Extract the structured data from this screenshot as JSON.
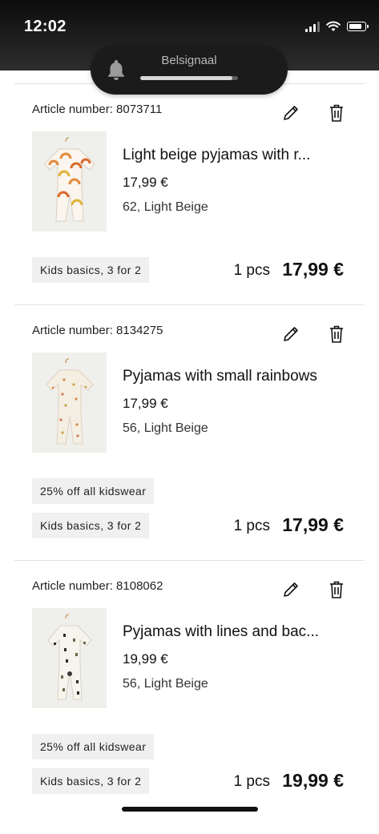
{
  "status_bar": {
    "time": "12:02"
  },
  "notification": {
    "title": "Belsignaal",
    "progress": 0.94
  },
  "cart_items": [
    {
      "article_label": "Article number: 8073711",
      "name": "Light beige pyjamas with r...",
      "price": "17,99 €",
      "variant": "62, Light Beige",
      "promotions": [
        "Kids basics, 3 for 2"
      ],
      "quantity": "1 pcs",
      "total": "17,99 €"
    },
    {
      "article_label": "Article number: 8134275",
      "name": "Pyjamas with small rainbows",
      "price": "17,99 €",
      "variant": "56, Light Beige",
      "promotions": [
        "25% off all kidswear",
        "Kids basics, 3 for 2"
      ],
      "quantity": "1 pcs",
      "total": "17,99 €"
    },
    {
      "article_label": "Article number: 8108062",
      "name": "Pyjamas with lines and bac...",
      "price": "19,99 €",
      "variant": "56, Light Beige",
      "promotions": [
        "25% off all kidswear",
        "Kids basics, 3 for 2"
      ],
      "quantity": "1 pcs",
      "total": "19,99 €"
    }
  ],
  "colors": {
    "status_bar_bg": "#1a1a1a",
    "notification_bg": "#1b1b1b",
    "badge_bg": "#f0f0f0",
    "divider": "#e2e2e2",
    "text": "#111111"
  },
  "icons": {
    "edit": "pencil-icon",
    "delete": "trash-icon",
    "notification": "bell-icon"
  }
}
